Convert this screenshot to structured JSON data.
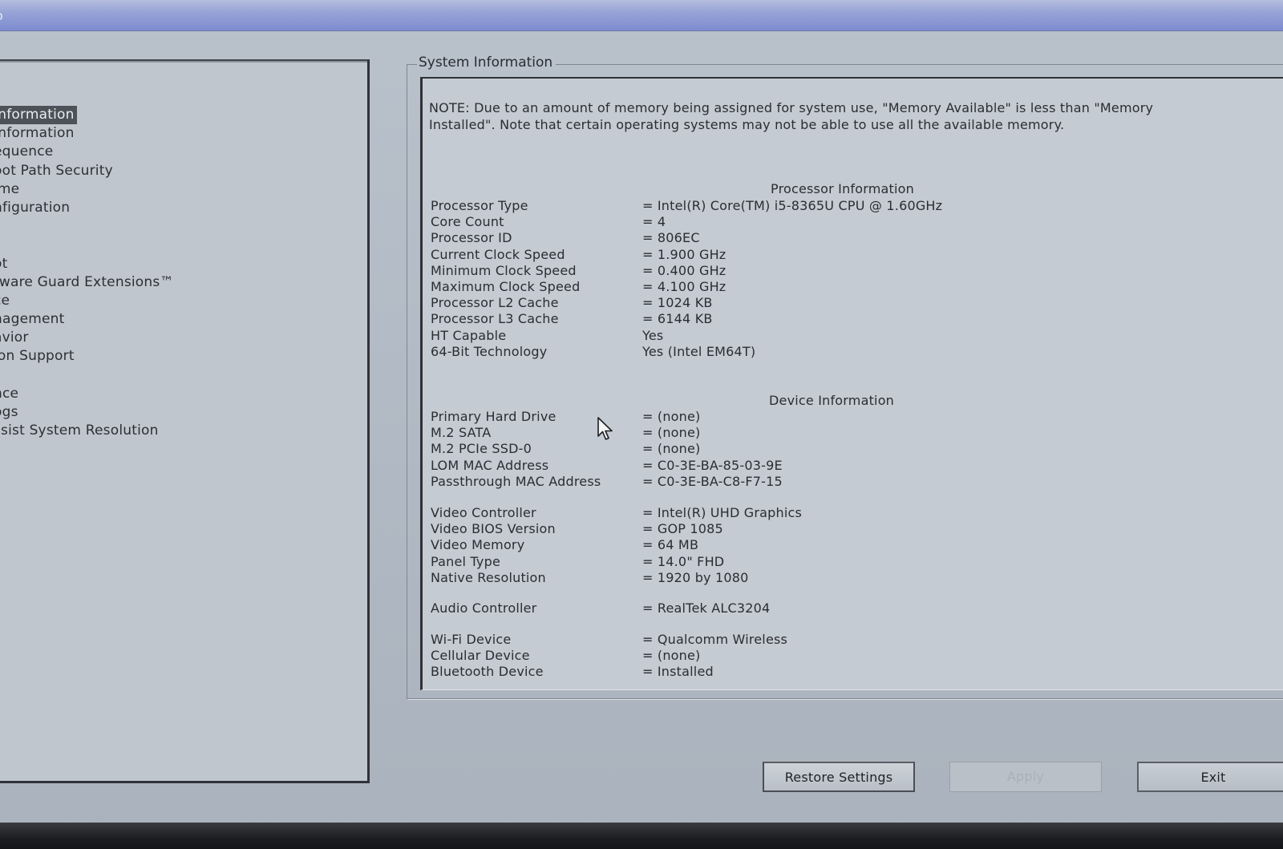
{
  "titlebar": {
    "glyph": "o"
  },
  "nav": {
    "items": [
      {
        "label": "Information",
        "selected": true
      },
      {
        "label": "Information"
      },
      {
        "label": "equence"
      },
      {
        "label": "oot Path Security"
      },
      {
        "label": "ime"
      },
      {
        "label": "nfiguration"
      },
      {
        "label": ""
      },
      {
        "label": ""
      },
      {
        "label": "ot"
      },
      {
        "label": "tware Guard Extensions™"
      },
      {
        "label": "ce"
      },
      {
        "label": "nagement"
      },
      {
        "label": "avior"
      },
      {
        "label": "ion Support"
      },
      {
        "label": ""
      },
      {
        "label": "nce"
      },
      {
        "label": "ogs"
      },
      {
        "label": "ssist System Resolution"
      }
    ]
  },
  "main": {
    "group_title": "System Information",
    "note": "NOTE: Due to an amount of memory being assigned for system use, \"Memory Available\" is less than \"Memory Installed\". Note that certain operating systems may not be able to use all the available memory.",
    "processor": {
      "heading": "Processor Information",
      "rows": [
        {
          "k": "Processor Type",
          "v": "= Intel(R) Core(TM) i5-8365U CPU @ 1.60GHz"
        },
        {
          "k": "Core Count",
          "v": "= 4"
        },
        {
          "k": "Processor ID",
          "v": "= 806EC"
        },
        {
          "k": "Current Clock Speed",
          "v": "= 1.900 GHz"
        },
        {
          "k": "Minimum Clock Speed",
          "v": "= 0.400 GHz"
        },
        {
          "k": "Maximum Clock Speed",
          "v": "= 4.100 GHz"
        },
        {
          "k": "Processor L2 Cache",
          "v": "= 1024 KB"
        },
        {
          "k": "Processor L3 Cache",
          "v": "= 6144 KB"
        },
        {
          "k": "HT Capable",
          "v": "Yes"
        },
        {
          "k": "64-Bit Technology",
          "v": "Yes (Intel EM64T)"
        }
      ]
    },
    "device": {
      "heading": "Device Information",
      "storage": [
        {
          "k": "Primary Hard Drive",
          "v": "= (none)"
        },
        {
          "k": "M.2 SATA",
          "v": "= (none)"
        },
        {
          "k": "M.2 PCIe SSD-0",
          "v": "= (none)"
        },
        {
          "k": "LOM MAC Address",
          "v": "= C0-3E-BA-85-03-9E"
        },
        {
          "k": "Passthrough MAC Address",
          "v": "= C0-3E-BA-C8-F7-15"
        }
      ],
      "video": [
        {
          "k": "Video Controller",
          "v": "= Intel(R) UHD Graphics"
        },
        {
          "k": "Video BIOS Version",
          "v": "= GOP 1085"
        },
        {
          "k": "Video Memory",
          "v": "= 64 MB"
        },
        {
          "k": "Panel Type",
          "v": "= 14.0\" FHD"
        },
        {
          "k": "Native Resolution",
          "v": "= 1920 by 1080"
        }
      ],
      "audio": [
        {
          "k": "Audio Controller",
          "v": "= RealTek ALC3204"
        }
      ],
      "wireless": [
        {
          "k": "Wi-Fi Device",
          "v": "= Qualcomm Wireless"
        },
        {
          "k": "Cellular Device",
          "v": "= (none)"
        },
        {
          "k": "Bluetooth Device",
          "v": "= Installed"
        }
      ]
    }
  },
  "buttons": {
    "restore": "Restore Settings",
    "apply": "Apply",
    "exit": "Exit"
  },
  "icons": {
    "cursor": "mouse-pointer-icon"
  }
}
